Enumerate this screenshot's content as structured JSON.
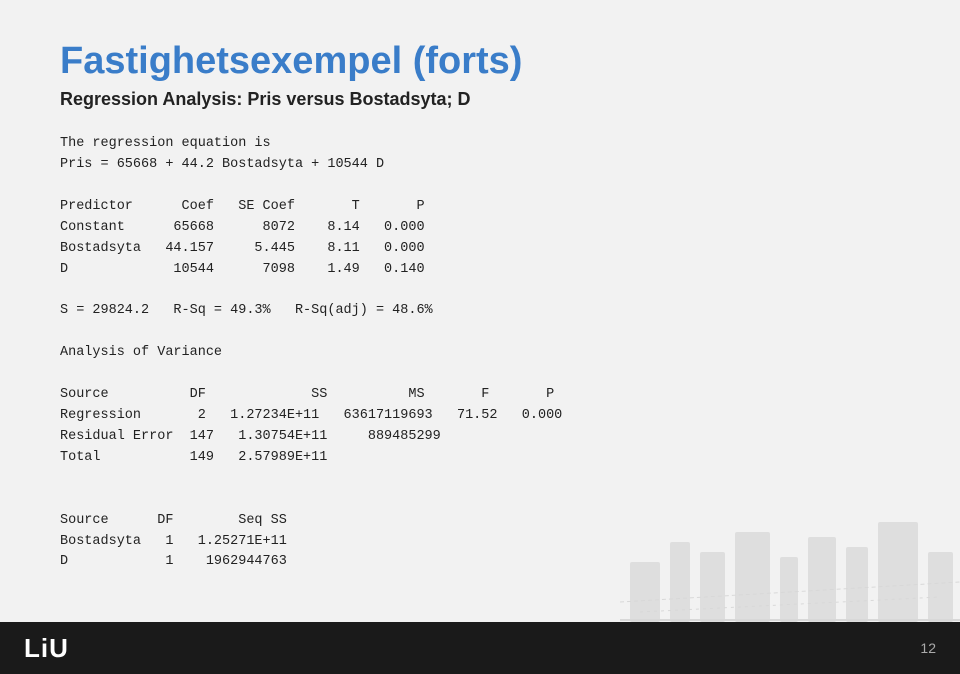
{
  "title": "Fastighetsexempel (forts)",
  "subtitle": "Regression Analysis: Pris versus Bostadsyta; D",
  "content_lines": [
    "The regression equation is",
    "Pris = 65668 + 44.2 Bostadsyta + 10544 D",
    "",
    "Predictor      Coef   SE Coef       T       P",
    "Constant      65668      8072    8.14   0.000",
    "Bostadsyta   44.157     5.445    8.11   0.000",
    "D             10544      7098    1.49   0.140",
    "",
    "S = 29824.2   R-Sq = 49.3%   R-Sq(adj) = 48.6%",
    "",
    "Analysis of Variance",
    "",
    "Source          DF             SS          MS       F       P",
    "Regression       2   1.27234E+11   63617119693   71.52   0.000",
    "Residual Error  147   1.30754E+11     889485299",
    "Total           149   2.57989E+11",
    "",
    "",
    "Source      DF        Seq SS",
    "Bostadsyta   1   1.25271E+11",
    "D            1    1962944763"
  ],
  "logo": "LiU",
  "page_number": "12"
}
